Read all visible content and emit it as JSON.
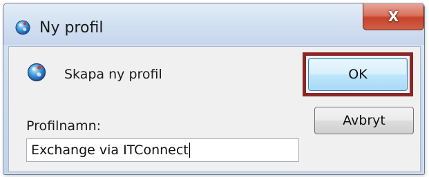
{
  "window": {
    "title": "Ny profil",
    "title_icon": "outlook-globe-icon",
    "close_label": "X"
  },
  "dialog": {
    "subtitle": "Skapa ny profil",
    "subtitle_icon": "outlook-globe-icon",
    "field_label": "Profilnamn:",
    "field_value": "Exchange via ITConnect"
  },
  "buttons": {
    "ok_label": "OK",
    "cancel_label": "Avbryt"
  },
  "highlight_color": "#8c2525"
}
